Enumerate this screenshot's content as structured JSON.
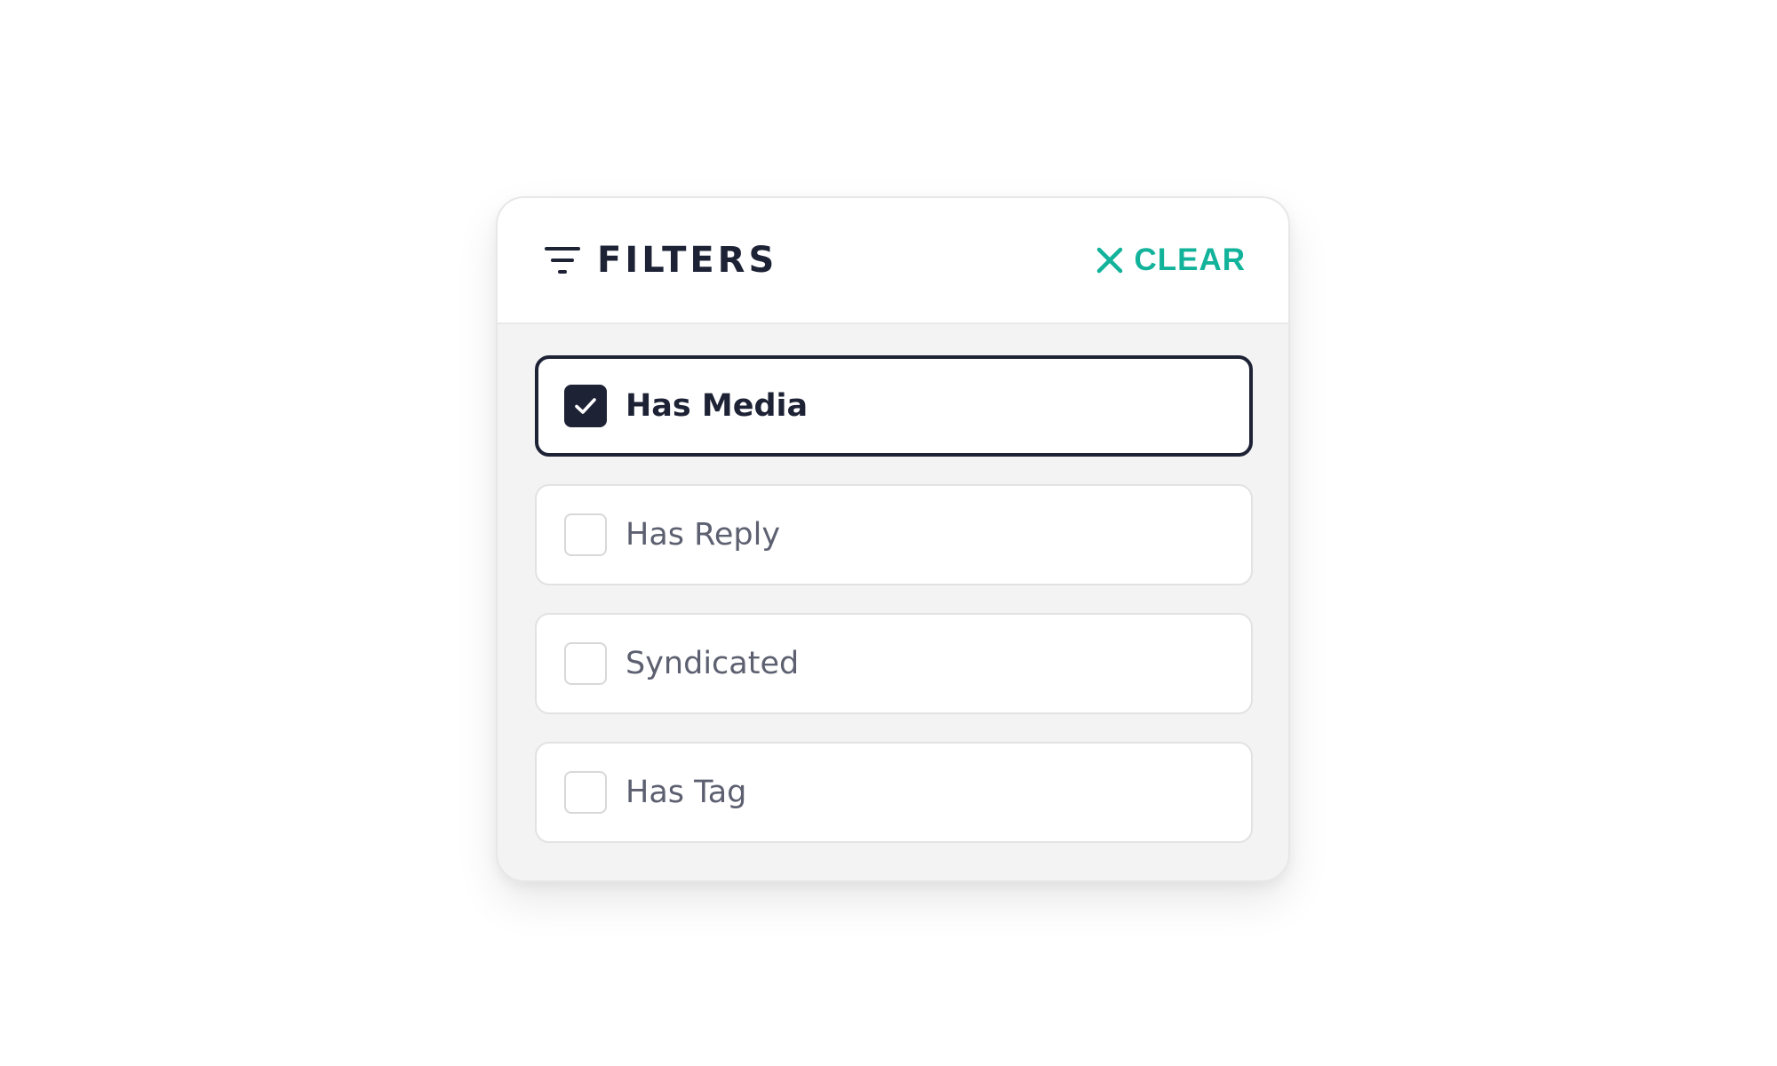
{
  "header": {
    "title": "FILTERS",
    "filter_icon": "filter-lines-icon",
    "clear_label": "CLEAR",
    "clear_icon": "close-icon"
  },
  "options": [
    {
      "label": "Has Media",
      "checked": true
    },
    {
      "label": "Has Reply",
      "checked": false
    },
    {
      "label": "Syndicated",
      "checked": false
    },
    {
      "label": "Has Tag",
      "checked": false
    }
  ],
  "colors": {
    "primary": "#1e2235",
    "accent": "#12b39a",
    "muted_text": "#5d6070",
    "panel_background": "#f3f3f3"
  }
}
